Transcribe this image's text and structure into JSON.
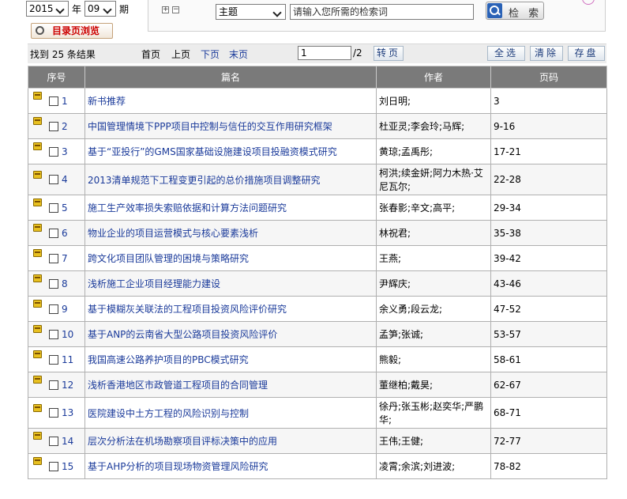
{
  "filters": {
    "year": "2015",
    "year_label": "年",
    "issue": "09",
    "issue_label": "期",
    "directory_button": "目录页浏览"
  },
  "search": {
    "field": "主题",
    "placeholder": "请输入您所需的检索词",
    "button": "检 索",
    "expand": "+",
    "collapse": "−"
  },
  "toolbar": {
    "result_count": "找到 25 条结果",
    "first": "首页",
    "prev": "上页",
    "next": "下页",
    "last": "末页",
    "page_value": "1",
    "page_total": "/2",
    "go": "转页",
    "select_all": "全选",
    "clear": "清除",
    "save": "存盘"
  },
  "table": {
    "headers": [
      "序号",
      "篇名",
      "作者",
      "页码"
    ],
    "rows": [
      {
        "seq": "1",
        "title": "新书推荐",
        "author": "刘日明;",
        "pages": "3"
      },
      {
        "seq": "2",
        "title": "中国管理情境下PPP项目中控制与信任的交互作用研究框架",
        "author": "杜亚灵;李会玲;马辉;",
        "pages": "9-16"
      },
      {
        "seq": "3",
        "title": "基于“亚投行”的GMS国家基础设施建设项目投融资模式研究",
        "author": "黄琼;孟禹彤;",
        "pages": "17-21"
      },
      {
        "seq": "4",
        "title": "2013清单规范下工程变更引起的总价措施项目调整研究",
        "author": "柯洪;续金妍;阿力木热·艾尼瓦尔;",
        "pages": "22-28"
      },
      {
        "seq": "5",
        "title": "施工生产效率损失索赔依据和计算方法问题研究",
        "author": "张春影;辛文;高平;",
        "pages": "29-34"
      },
      {
        "seq": "6",
        "title": "物业企业的项目运营模式与核心要素浅析",
        "author": "林祝君;",
        "pages": "35-38"
      },
      {
        "seq": "7",
        "title": "跨文化项目团队管理的困境与策略研究",
        "author": "王燕;",
        "pages": "39-42"
      },
      {
        "seq": "8",
        "title": "浅析施工企业项目经理能力建设",
        "author": "尹辉庆;",
        "pages": "43-46"
      },
      {
        "seq": "9",
        "title": "基于模糊灰关联法的工程项目投资风险评价研究",
        "author": "余义勇;段云龙;",
        "pages": "47-52"
      },
      {
        "seq": "10",
        "title": "基于ANP的云南省大型公路项目投资风险评价",
        "author": "孟笋;张诚;",
        "pages": "53-57"
      },
      {
        "seq": "11",
        "title": "我国高速公路养护项目的PBC模式研究",
        "author": "熊毅;",
        "pages": "58-61"
      },
      {
        "seq": "12",
        "title": "浅析香港地区市政管道工程项目的合同管理",
        "author": "董继柏;戴昊;",
        "pages": "62-67"
      },
      {
        "seq": "13",
        "title": "医院建设中土方工程的风险识别与控制",
        "author": "徐丹;张玉彬;赵奕华;严鹏华;",
        "pages": "68-71"
      },
      {
        "seq": "14",
        "title": "层次分析法在机场勘察项目评标决策中的应用",
        "author": "王伟;王健;",
        "pages": "72-77"
      },
      {
        "seq": "15",
        "title": "基于AHP分析的项目现场物资管理风险研究",
        "author": "凌霄;余滨;刘进波;",
        "pages": "78-82"
      }
    ]
  }
}
